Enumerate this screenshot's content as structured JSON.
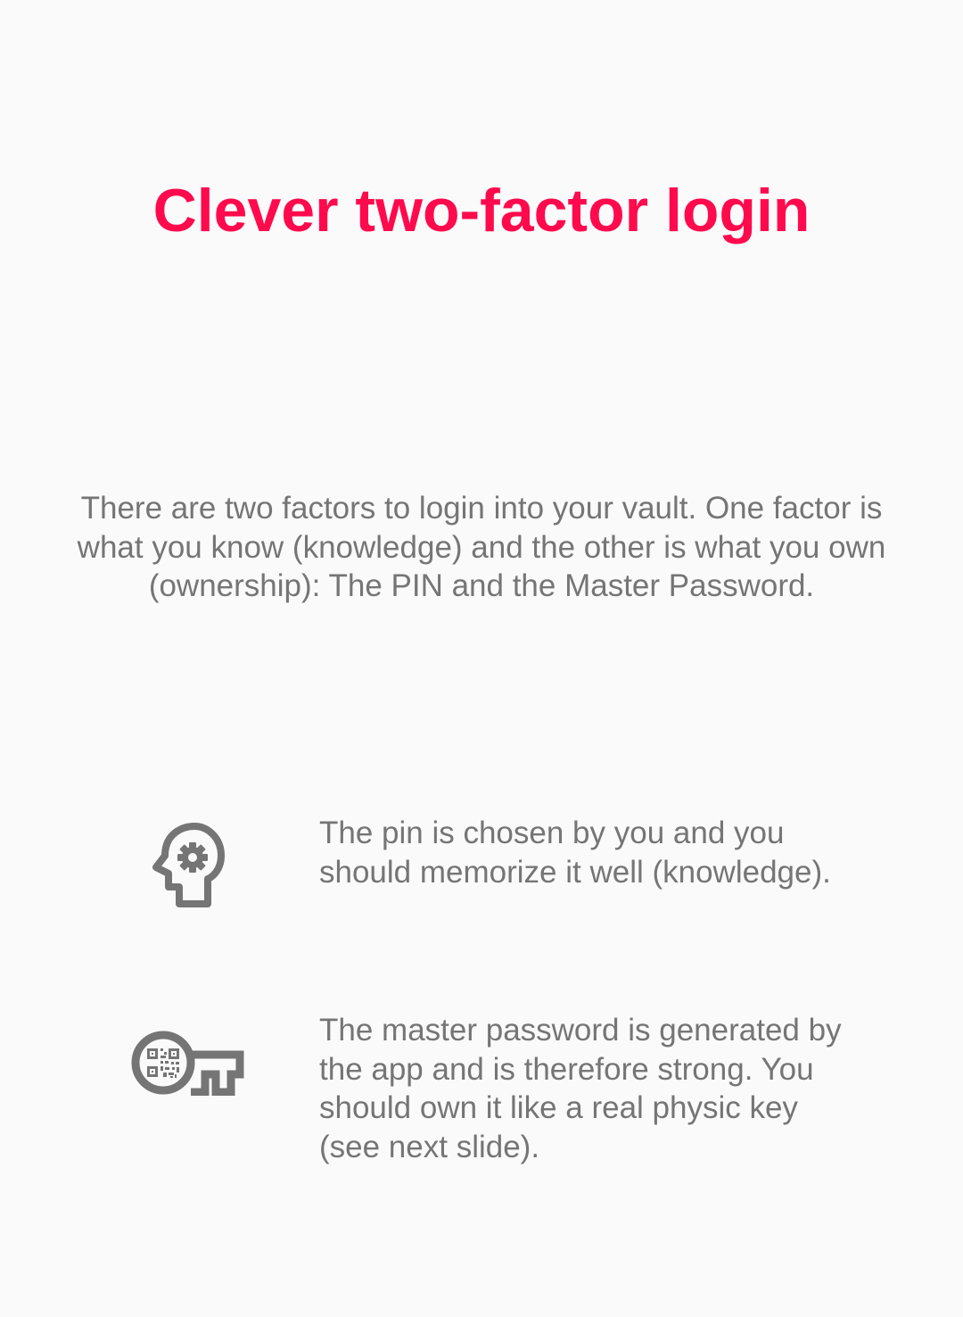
{
  "slide": {
    "title": "Clever two-factor login",
    "intro": "There are two factors to login into your vault. One factor is what you know (knowledge) and the other is what you own (ownership): The PIN and the Master Password.",
    "features": [
      {
        "icon": "head-gear-icon",
        "text": "The pin is chosen by you and you should memorize it well (knowledge)."
      },
      {
        "icon": "key-qr-icon",
        "text": "The master password is generated by the app and is therefore strong. You should own it like a real physic key (see next slide)."
      }
    ]
  },
  "colors": {
    "title": "#ff0a4d",
    "text": "#757575",
    "icon": "#757575",
    "background": "#fafafa"
  }
}
